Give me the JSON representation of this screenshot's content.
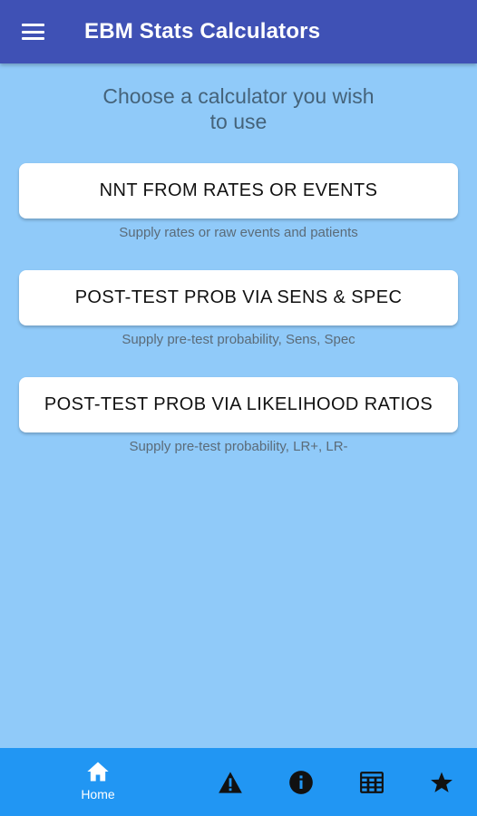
{
  "app_bar": {
    "title": "EBM Stats Calculators",
    "menu_icon": "hamburger-menu-icon"
  },
  "main": {
    "prompt": "Choose a calculator you wish to use",
    "calculators": [
      {
        "label": "NNT FROM RATES OR EVENTS",
        "caption": "Supply rates or raw events and patients"
      },
      {
        "label": "POST-TEST PROB VIA SENS & SPEC",
        "caption": "Supply pre-test probability, Sens, Spec"
      },
      {
        "label": "POST-TEST PROB VIA LIKELIHOOD RATIOS",
        "caption": "Supply pre-test probability, LR+, LR-"
      }
    ]
  },
  "bottom_nav": {
    "items": [
      {
        "label": "Home",
        "icon": "home-icon",
        "active": true
      },
      {
        "icon": "warning-icon"
      },
      {
        "icon": "info-icon"
      },
      {
        "icon": "calculator-icon"
      },
      {
        "icon": "star-icon"
      }
    ]
  },
  "colors": {
    "app_bar": "#3f51b5",
    "background": "#90caf9",
    "bottom_nav": "#2196f3",
    "card": "#ffffff"
  }
}
